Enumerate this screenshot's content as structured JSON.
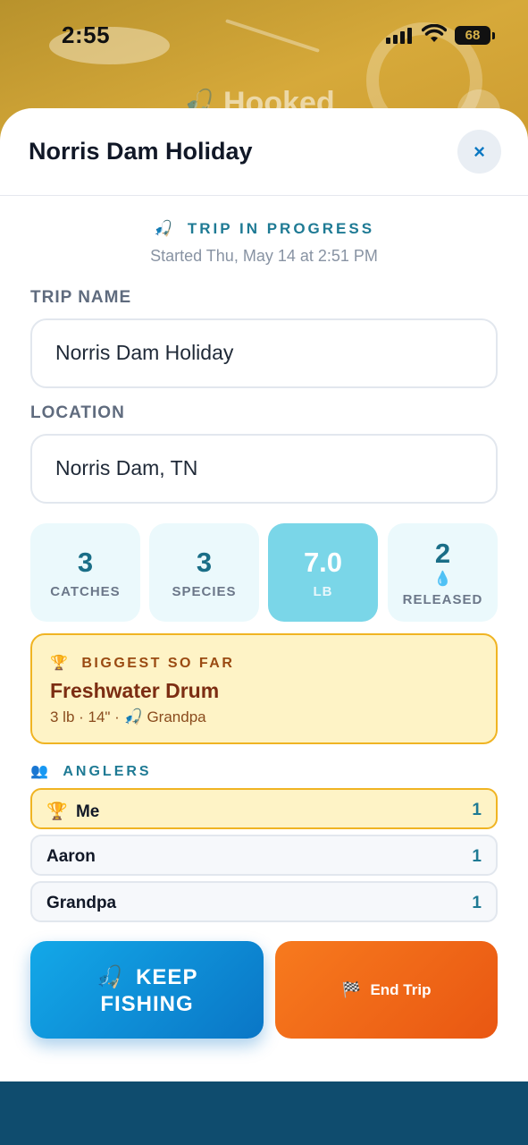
{
  "status_bar": {
    "time": "2:55",
    "battery": "68"
  },
  "background": {
    "app_title": "Hooked"
  },
  "sheet": {
    "title": "Norris Dam Holiday",
    "close_symbol": "×"
  },
  "trip": {
    "status_icon": "🎣",
    "status": "TRIP IN PROGRESS",
    "started": "Started Thu, May 14 at 2:51 PM"
  },
  "fields": {
    "trip_name_label": "TRIP NAME",
    "trip_name_value": "Norris Dam Holiday",
    "location_label": "LOCATION",
    "location_value": "Norris Dam, TN"
  },
  "stats": [
    {
      "value": "3",
      "label": "CATCHES"
    },
    {
      "value": "3",
      "label": "SPECIES"
    },
    {
      "value": "7.0",
      "label": "LB"
    },
    {
      "value": "2",
      "label": "RELEASED",
      "icon": "💧"
    }
  ],
  "biggest": {
    "icon": "🏆",
    "label": "BIGGEST SO FAR",
    "name": "Freshwater Drum",
    "meta": "3 lb · 14\" · 🎣 Grandpa"
  },
  "anglers": {
    "icon": "👥",
    "label": "ANGLERS",
    "list": [
      {
        "name": "Me",
        "count": "1",
        "leader_icon": "🏆"
      },
      {
        "name": "Aaron",
        "count": "1"
      },
      {
        "name": "Grandpa",
        "count": "1"
      }
    ]
  },
  "actions": {
    "keep_icon": "🎣",
    "keep_line1": "KEEP",
    "keep_line2": "FISHING",
    "end_icon": "🏁",
    "end_label": "End Trip"
  },
  "colors": {
    "accent": "#1e7a94",
    "keep_button": "#0a76c6",
    "end_button": "#e95712",
    "highlight": "#fef3c6"
  }
}
